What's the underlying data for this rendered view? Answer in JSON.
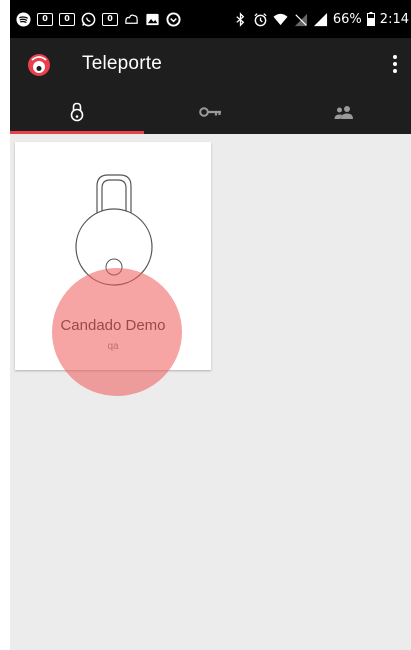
{
  "status_bar": {
    "icons_left": [
      "spotify-icon",
      "outlook-icon",
      "outlook-icon",
      "whatsapp-icon",
      "outlook-icon",
      "dropbox-icon",
      "gallery-icon",
      "opera-icon"
    ],
    "outlook_badge": "0",
    "icons_right": [
      "bluetooth-icon",
      "alarm-icon",
      "wifi-icon",
      "no-sim-icon",
      "signal-icon"
    ],
    "battery_text": "66%",
    "time": "2:14"
  },
  "app_bar": {
    "title": "Teleporte",
    "brand_color": "#e8414d"
  },
  "tabs": [
    {
      "name": "locks",
      "icon": "padlock-icon",
      "active": true
    },
    {
      "name": "keys",
      "icon": "key-icon",
      "active": false
    },
    {
      "name": "users",
      "icon": "people-icon",
      "active": false
    }
  ],
  "lock_card": {
    "title": "Candado Demo",
    "subtitle": "qa"
  },
  "colors": {
    "accent": "#e8414d",
    "app_bar": "#1e1e1e",
    "background": "#ececec"
  }
}
